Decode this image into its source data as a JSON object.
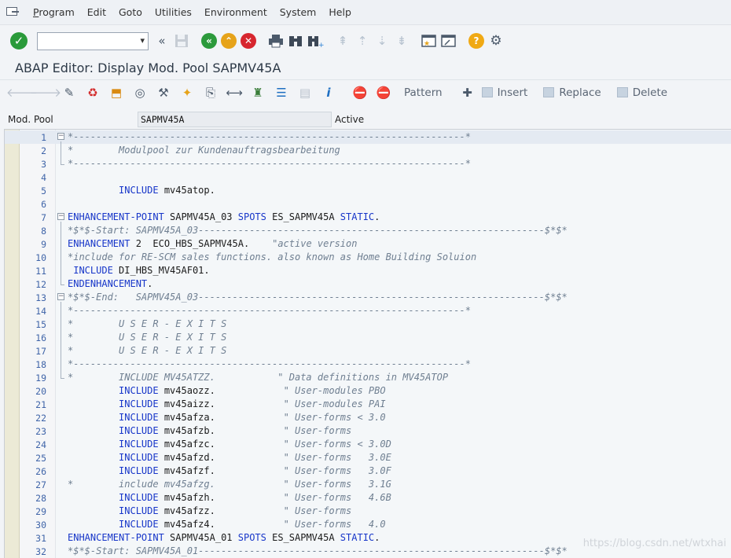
{
  "menu": [
    "Program",
    "Edit",
    "Goto",
    "Utilities",
    "Environment",
    "System",
    "Help"
  ],
  "menu_underline": [
    "P",
    "E",
    "G",
    "U",
    "n",
    "S",
    "H"
  ],
  "title": "ABAP Editor: Display Mod. Pool SAPMV45A",
  "toolbar_icons": [
    "enter-icon",
    "command-field",
    "collapse-icon",
    "save-icon",
    "back-icon",
    "exit-icon",
    "cancel-icon",
    "print-icon",
    "find-icon",
    "find-next-icon",
    "first-page-icon",
    "previous-page-icon",
    "next-page-icon",
    "last-page-icon",
    "new-session-icon",
    "shortcut-icon",
    "help-icon",
    "settings-icon"
  ],
  "app_toolbar": {
    "pattern": "Pattern",
    "insert": "Insert",
    "replace": "Replace",
    "delete": "Delete"
  },
  "info": {
    "label": "Mod. Pool",
    "program": "SAPMV45A",
    "status": "Active"
  },
  "watermark": "https://blog.csdn.net/wtxhai",
  "lines": [
    {
      "n": "1",
      "t": "*---------------------------------------------------------------------*"
    },
    {
      "n": "2",
      "t": "*        Modulpool zur Kundenauftragsbearbeitung"
    },
    {
      "n": "3",
      "t": "*---------------------------------------------------------------------*"
    },
    {
      "n": "4",
      "t": ""
    },
    {
      "n": "5",
      "t": "         INCLUDE mv45atop."
    },
    {
      "n": "6",
      "t": ""
    },
    {
      "n": "7",
      "t": "ENHANCEMENT-POINT SAPMV45A_03 SPOTS ES_SAPMV45A STATIC."
    },
    {
      "n": "8",
      "t": "*$*$-Start: SAPMV45A_03-------------------------------------------------------------$*$*"
    },
    {
      "n": "9",
      "t": "ENHANCEMENT 2  ECO_HBS_SAPMV45A.    \"active version"
    },
    {
      "n": "10",
      "t": "*include for RE-SCM sales functions. also known as Home Building Soluion"
    },
    {
      "n": "11",
      "t": " INCLUDE DI_HBS_MV45AF01."
    },
    {
      "n": "12",
      "t": "ENDENHANCEMENT."
    },
    {
      "n": "13",
      "t": "*$*$-End:   SAPMV45A_03-------------------------------------------------------------$*$*"
    },
    {
      "n": "14",
      "t": "*---------------------------------------------------------------------*"
    },
    {
      "n": "15",
      "t": "*        U S E R - E X I T S"
    },
    {
      "n": "16",
      "t": "*        U S E R - E X I T S"
    },
    {
      "n": "17",
      "t": "*        U S E R - E X I T S"
    },
    {
      "n": "18",
      "t": "*---------------------------------------------------------------------*"
    },
    {
      "n": "19",
      "t": "*        INCLUDE MV45ATZZ.           \" Data definitions in MV45ATOP"
    },
    {
      "n": "20",
      "t": "         INCLUDE mv45aozz.            \" User-modules PBO"
    },
    {
      "n": "21",
      "t": "         INCLUDE mv45aizz.            \" User-modules PAI"
    },
    {
      "n": "22",
      "t": "         INCLUDE mv45afza.            \" User-forms < 3.0"
    },
    {
      "n": "23",
      "t": "         INCLUDE mv45afzb.            \" User-forms"
    },
    {
      "n": "24",
      "t": "         INCLUDE mv45afzc.            \" User-forms < 3.0D"
    },
    {
      "n": "25",
      "t": "         INCLUDE mv45afzd.            \" User-forms   3.0E"
    },
    {
      "n": "26",
      "t": "         INCLUDE mv45afzf.            \" User-forms   3.0F"
    },
    {
      "n": "27",
      "t": "*        include mv45afzg.            \" User-forms   3.1G"
    },
    {
      "n": "28",
      "t": "         INCLUDE mv45afzh.            \" User-forms   4.6B"
    },
    {
      "n": "29",
      "t": "         INCLUDE mv45afzz.            \" User-forms"
    },
    {
      "n": "30",
      "t": "         INCLUDE mv45afz4.            \" User-forms   4.0"
    },
    {
      "n": "31",
      "t": "ENHANCEMENT-POINT SAPMV45A_01 SPOTS ES_SAPMV45A STATIC."
    },
    {
      "n": "32",
      "t": "*$*$-Start: SAPMV45A_01-------------------------------------------------------------$*$*"
    }
  ]
}
